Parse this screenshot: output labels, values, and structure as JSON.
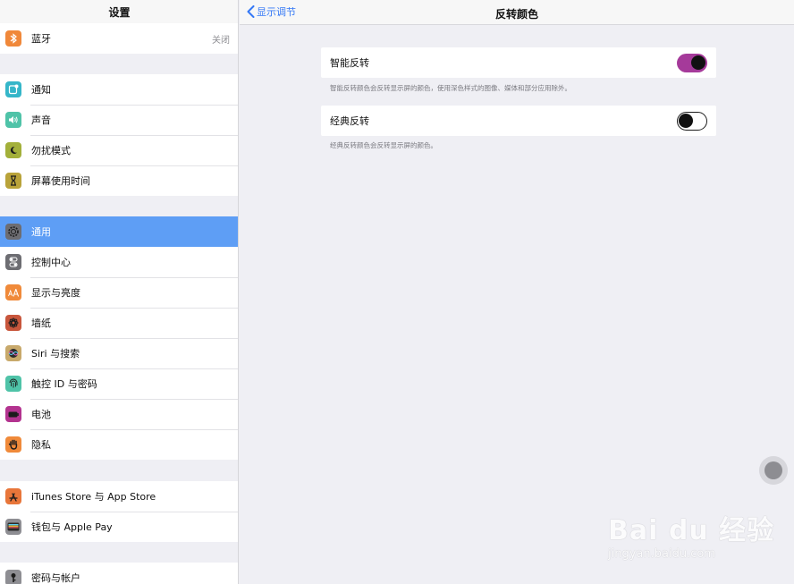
{
  "sidebar": {
    "title": "设置",
    "groups": [
      {
        "items": [
          {
            "label": "蓝牙",
            "value": "关闭",
            "icon": "bluetooth-icon",
            "color": "#f0883a"
          }
        ]
      },
      {
        "items": [
          {
            "label": "通知",
            "icon": "notifications-icon",
            "color": "#35b6c9"
          },
          {
            "label": "声音",
            "icon": "sound-icon",
            "color": "#4fc3a8"
          },
          {
            "label": "勿扰模式",
            "icon": "moon-icon",
            "color": "#a3b03a"
          },
          {
            "label": "屏幕使用时间",
            "icon": "hourglass-icon",
            "color": "#b9a33a"
          }
        ]
      },
      {
        "items": [
          {
            "label": "通用",
            "icon": "gear-icon",
            "color": "#6d6d72",
            "selected": true
          },
          {
            "label": "控制中心",
            "icon": "switches-icon",
            "color": "#6d6d72"
          },
          {
            "label": "显示与亮度",
            "icon": "display-icon",
            "color": "#f08a3a"
          },
          {
            "label": "墙纸",
            "icon": "wallpaper-icon",
            "color": "#c8563c"
          },
          {
            "label": "Siri 与搜索",
            "icon": "siri-icon",
            "color": "#c8a96b"
          },
          {
            "label": "触控 ID 与密码",
            "icon": "fingerprint-icon",
            "color": "#4fc3a8"
          },
          {
            "label": "电池",
            "icon": "battery-icon",
            "color": "#b3338f"
          },
          {
            "label": "隐私",
            "icon": "hand-icon",
            "color": "#f08a3a"
          }
        ]
      },
      {
        "items": [
          {
            "label": "iTunes Store 与 App Store",
            "icon": "app-store-icon",
            "color": "#e8763a"
          },
          {
            "label": "钱包与 Apple Pay",
            "icon": "wallet-icon",
            "color": "#8e8e93"
          }
        ]
      },
      {
        "items": [
          {
            "label": "密码与帐户",
            "icon": "key-icon",
            "color": "#8e8e93"
          }
        ]
      }
    ]
  },
  "header": {
    "back_label": "显示调节",
    "title": "反转颜色"
  },
  "settings": [
    {
      "label": "智能反转",
      "on": true,
      "note": "智能反转颜色会反转显示屏的颜色，使用深色样式的图像、媒体和部分应用除外。"
    },
    {
      "label": "经典反转",
      "on": false,
      "note": "经典反转颜色会反转显示屏的颜色。"
    }
  ],
  "colors": {
    "accent": "#3478f6",
    "selected_row": "#5e9ef5",
    "toggle_on": "#a53a9a"
  },
  "watermark": {
    "main": "Bai du 经验",
    "sub": "jingyan.baidu.com"
  }
}
